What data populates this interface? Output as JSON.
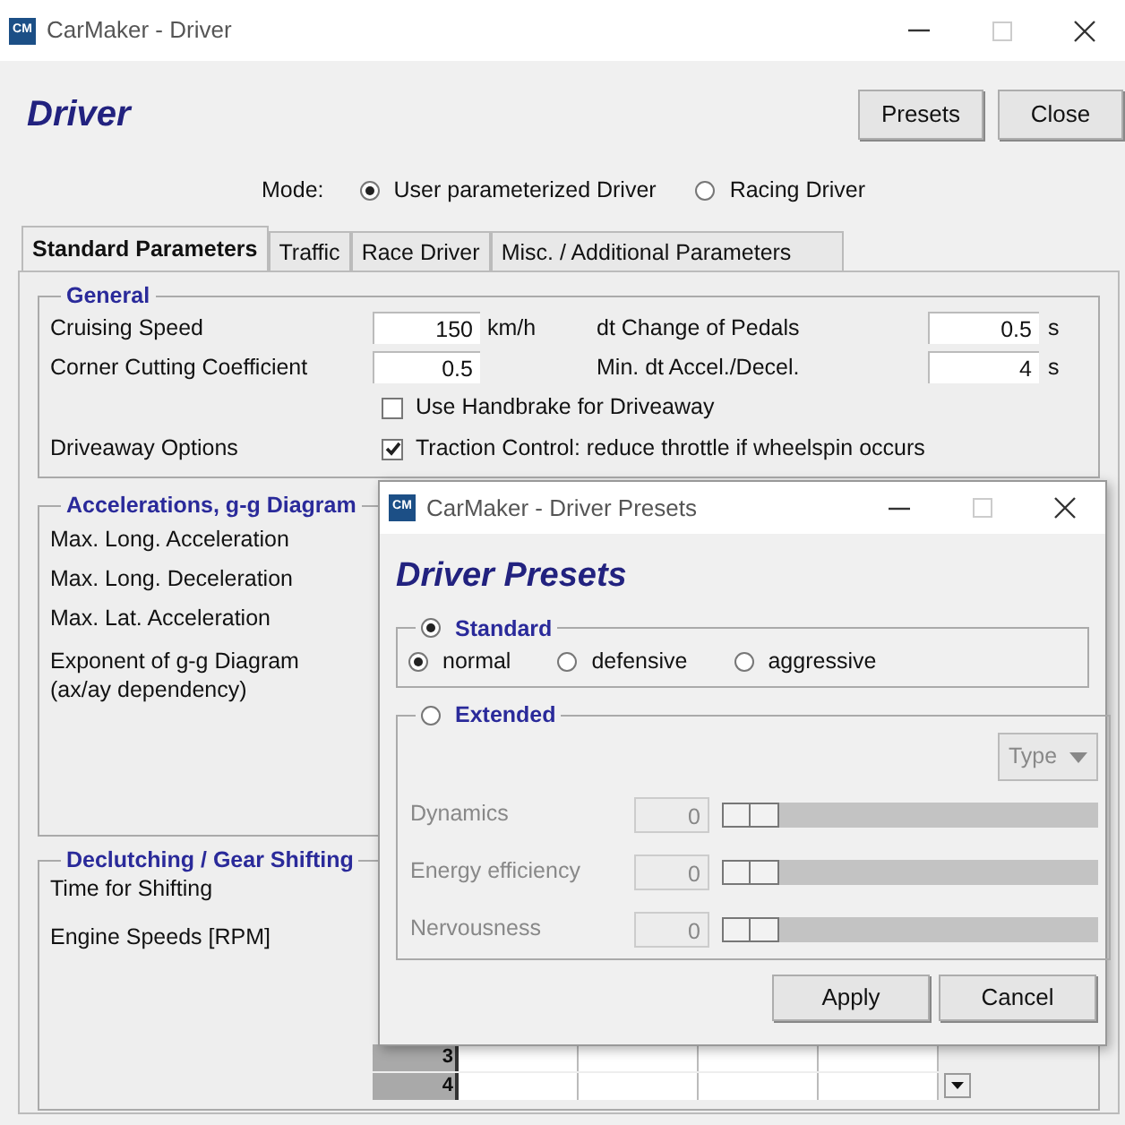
{
  "window": {
    "icon_text": "CM",
    "title": "CarMaker - Driver"
  },
  "header": {
    "title": "Driver",
    "buttons": [
      "Presets",
      "Close"
    ]
  },
  "mode": {
    "label": "Mode:",
    "options": [
      {
        "label": "User parameterized Driver",
        "selected": true
      },
      {
        "label": "Racing Driver",
        "selected": false
      }
    ]
  },
  "tabs": [
    {
      "label": "Standard Parameters",
      "selected": true
    },
    {
      "label": "Traffic",
      "selected": false
    },
    {
      "label": "Race Driver",
      "selected": false
    },
    {
      "label": "Misc. / Additional Parameters",
      "selected": false
    }
  ],
  "general": {
    "title": "General",
    "fields": [
      {
        "label": "Cruising Speed",
        "value": "150",
        "unit": "km/h",
        "right_label": "dt Change of Pedals",
        "right_value": "0.5",
        "right_unit": "s"
      },
      {
        "label": "Corner Cutting Coefficient",
        "value": "0.5",
        "right_label": "Min. dt Accel./Decel.",
        "right_value": "4",
        "right_unit": "s"
      }
    ],
    "checkboxes": [
      {
        "label": "Use Handbrake for Driveaway",
        "checked": false
      },
      {
        "row_label": "Driveaway Options",
        "label": "Traction Control: reduce throttle if wheelspin occurs",
        "checked": true
      }
    ]
  },
  "accelerations": {
    "title": "Accelerations, g-g Diagram",
    "labels": [
      {
        "text": "Max. Long. Acceleration"
      },
      {
        "text": "Max. Long. Deceleration"
      },
      {
        "text": "Max. Lat. Acceleration"
      },
      {
        "text": "Exponent of g-g Diagram",
        "note": "(ax/ay dependency)"
      }
    ]
  },
  "declutching": {
    "title": "Declutching / Gear Shifting",
    "labels": [
      "Time for Shifting",
      "Engine Speeds [RPM]"
    ],
    "table": {
      "rows": [
        {
          "header": "3",
          "dropdown": false
        },
        {
          "header": "4",
          "dropdown": true
        }
      ]
    }
  },
  "dialog": {
    "icon_text": "CM",
    "title": "CarMaker - Driver Presets",
    "heading": "Driver Presets",
    "standard": {
      "title": "Standard",
      "selected": true,
      "options": [
        {
          "label": "normal",
          "selected": true
        },
        {
          "label": "defensive",
          "selected": false
        },
        {
          "label": "aggressive",
          "selected": false
        }
      ]
    },
    "extended": {
      "title": "Extended",
      "selected": false,
      "type_button": "Type",
      "sliders": [
        {
          "label": "Dynamics",
          "value": "0"
        },
        {
          "label": "Energy efficiency",
          "value": "0"
        },
        {
          "label": "Nervousness",
          "value": "0"
        }
      ]
    },
    "buttons": [
      "Apply",
      "Cancel"
    ]
  }
}
